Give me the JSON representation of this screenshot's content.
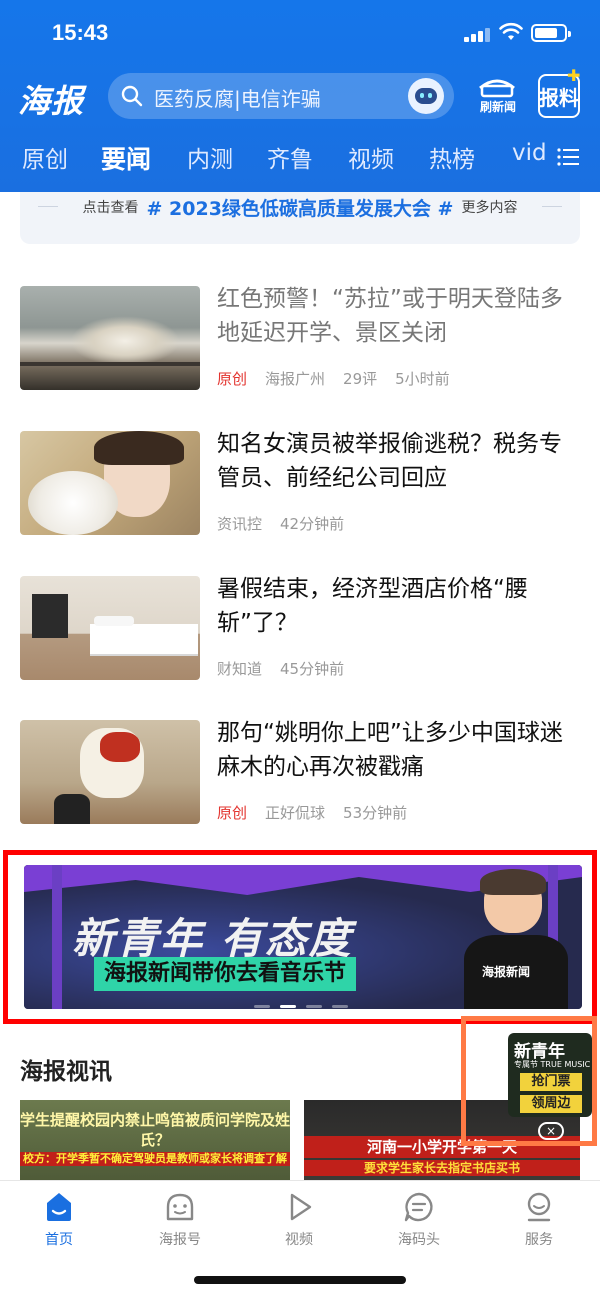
{
  "status_bar": {
    "time": "15:43"
  },
  "header": {
    "logo": "海报",
    "search_placeholder": "医药反腐|电信诈骗",
    "refresh_label": "刷新闻",
    "report_label": "报料"
  },
  "tabs": [
    {
      "label": "原创"
    },
    {
      "label": "要闻",
      "active": true
    },
    {
      "label": "内测"
    },
    {
      "label": "齐鲁"
    },
    {
      "label": "视频"
    },
    {
      "label": "热榜"
    },
    {
      "label": "vid"
    }
  ],
  "topic": {
    "prefix": "点击查看",
    "tag": "# 2023绿色低碳高质量发展大会 #",
    "suffix": "更多内容"
  },
  "news": [
    {
      "title": "红色预警！“苏拉”或于明天登陆多地延迟开学、景区关闭",
      "read": true,
      "badge": "原创",
      "source": "海报广州",
      "comments": "29评",
      "time": "5小时前"
    },
    {
      "title": "知名女演员被举报偷逃税？税务专管员、前经纪公司回应",
      "read": false,
      "badge": "",
      "source": "资讯控",
      "comments": "",
      "time": "42分钟前"
    },
    {
      "title": "暑假结束，经济型酒店价格“腰斩”了？",
      "read": false,
      "badge": "",
      "source": "财知道",
      "comments": "",
      "time": "45分钟前"
    },
    {
      "title": "那句“姚明你上吧”让多少中国球迷麻木的心再次被戳痛",
      "read": false,
      "badge": "原创",
      "source": "正好侃球",
      "comments": "",
      "time": "53分钟前"
    }
  ],
  "ad_banner": {
    "title": "新青年 有态度",
    "subtitle": "海报新闻带你去看音乐节",
    "shirt_text": "海报新闻",
    "slides": 4,
    "active_slide": 2
  },
  "video_section": {
    "title": "海报视讯",
    "videos": [
      {
        "caption": "学生提醒校园内禁止鸣笛被质问学院及姓氏？",
        "subcaption": "校方：开学季暂不确定驾驶员是教师或家长将调查了解"
      },
      {
        "caption": "河南一小学开学第一天",
        "subcaption": "要求学生家长去指定书店买书"
      }
    ]
  },
  "float_ad": {
    "title": "新青年",
    "small": "专属节 TRUE MUSIC",
    "button1": "抢门票",
    "button2": "领周边",
    "close": "×"
  },
  "bottom_nav": [
    {
      "label": "首页",
      "icon": "home-icon",
      "active": true
    },
    {
      "label": "海报号",
      "icon": "face-icon"
    },
    {
      "label": "视频",
      "icon": "play-icon"
    },
    {
      "label": "海码头",
      "icon": "chat-icon"
    },
    {
      "label": "服务",
      "icon": "user-icon"
    }
  ],
  "colors": {
    "brand": "#1a6fe0",
    "accent": "#ffce1e",
    "original_badge": "#e3342f"
  }
}
